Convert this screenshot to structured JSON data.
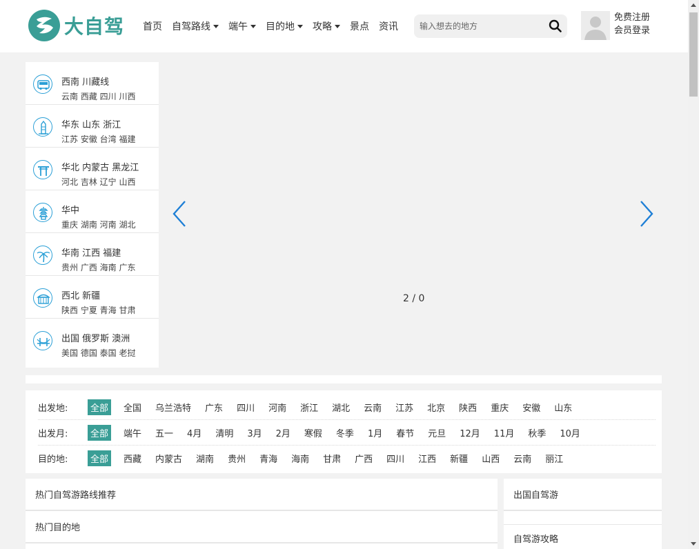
{
  "header": {
    "logo_text": "大自驾",
    "nav": [
      {
        "label": "首页",
        "dropdown": false
      },
      {
        "label": "自驾路线",
        "dropdown": true
      },
      {
        "label": "端午",
        "dropdown": true
      },
      {
        "label": "目的地",
        "dropdown": true
      },
      {
        "label": "攻略",
        "dropdown": true
      },
      {
        "label": "景点",
        "dropdown": false
      },
      {
        "label": "资讯",
        "dropdown": false
      }
    ],
    "search": {
      "placeholder": "输入想去的地方",
      "icon": "search-icon"
    },
    "user": {
      "register": "免费注册",
      "login": "会员登录"
    }
  },
  "regions": [
    {
      "title": "西南 川藏线",
      "sub": "云南 西藏 四川 川西",
      "icon": "car-icon"
    },
    {
      "title": "华东 山东 浙江",
      "sub": "江苏 安徽 台湾 福建",
      "icon": "building-icon"
    },
    {
      "title": "华北 内蒙古 黑龙江",
      "sub": "河北 吉林 辽宁 山西",
      "icon": "gate-icon"
    },
    {
      "title": "华中",
      "sub": "重庆 湖南 河南 湖北",
      "icon": "pagoda-icon"
    },
    {
      "title": "华南 江西 福建",
      "sub": "贵州 广西 海南 广东",
      "icon": "palm-icon"
    },
    {
      "title": "西北 新疆",
      "sub": "陕西 宁夏 青海 甘肃",
      "icon": "palace-icon"
    },
    {
      "title": "出国 俄罗斯 澳洲",
      "sub": "美国 德国 泰国 老挝",
      "icon": "bridge-icon"
    }
  ],
  "slider": {
    "pager": "2 / 0"
  },
  "filters": [
    {
      "label": "出发地:",
      "options": [
        "全部",
        "全国",
        "乌兰浩特",
        "广东",
        "四川",
        "河南",
        "浙江",
        "湖北",
        "云南",
        "江苏",
        "北京",
        "陕西",
        "重庆",
        "安徽",
        "山东"
      ]
    },
    {
      "label": "出发月:",
      "options": [
        "全部",
        "端午",
        "五一",
        "4月",
        "清明",
        "3月",
        "2月",
        "寒假",
        "冬季",
        "1月",
        "春节",
        "元旦",
        "12月",
        "11月",
        "秋季",
        "10月"
      ]
    },
    {
      "label": "目的地:",
      "options": [
        "全部",
        "西藏",
        "内蒙古",
        "湖南",
        "贵州",
        "青海",
        "海南",
        "甘肃",
        "广西",
        "四川",
        "江西",
        "新疆",
        "山西",
        "云南",
        "丽江"
      ]
    }
  ],
  "panels": {
    "hot_routes": "热门自驾游路线推荐",
    "hot_destinations": "热门目的地",
    "abroad": "出国自驾游",
    "guides": "自驾游攻略"
  },
  "colors": {
    "accent": "#3a9e96",
    "icon_blue": "#2a9fd6",
    "arrow_blue": "#1e7fd6"
  }
}
